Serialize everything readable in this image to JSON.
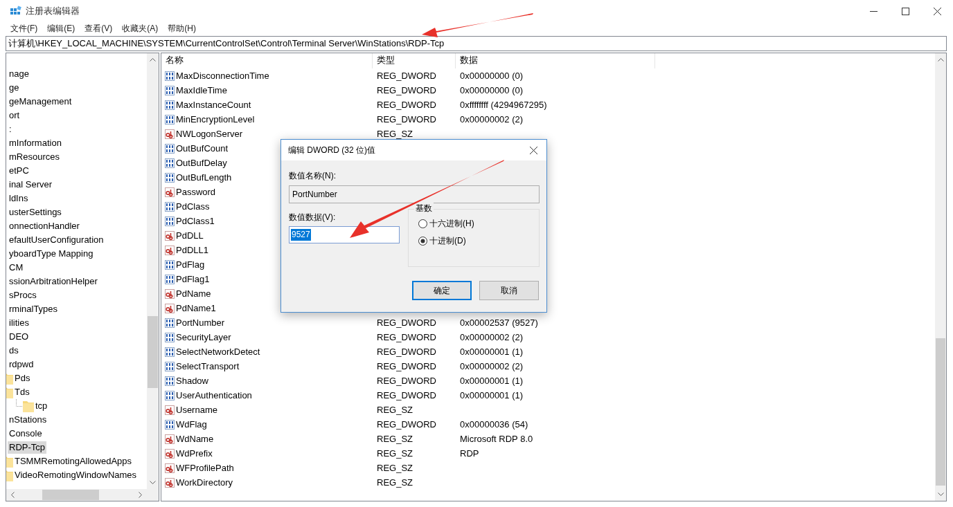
{
  "window": {
    "title": "注册表编辑器"
  },
  "menu": [
    "文件(F)",
    "编辑(E)",
    "查看(V)",
    "收藏夹(A)",
    "帮助(H)"
  ],
  "address": "计算机\\HKEY_LOCAL_MACHINE\\SYSTEM\\CurrentControlSet\\Control\\Terminal Server\\WinStations\\RDP-Tcp",
  "tree": [
    {
      "text": "nage",
      "selected": false
    },
    {
      "text": "ge",
      "selected": false
    },
    {
      "text": "geManagement",
      "selected": false
    },
    {
      "text": "ort",
      "selected": false
    },
    {
      "text": ":",
      "selected": false
    },
    {
      "text": "mInformation",
      "selected": false
    },
    {
      "text": "mResources",
      "selected": false
    },
    {
      "text": "etPC",
      "selected": false
    },
    {
      "text": "inal Server",
      "selected": false
    },
    {
      "text": "ldIns",
      "selected": false
    },
    {
      "text": "usterSettings",
      "selected": false
    },
    {
      "text": "onnectionHandler",
      "selected": false
    },
    {
      "text": "efaultUserConfiguration",
      "selected": false
    },
    {
      "text": "yboardType Mapping",
      "selected": false
    },
    {
      "text": "CM",
      "selected": false
    },
    {
      "text": "ssionArbitrationHelper",
      "selected": false
    },
    {
      "text": "sProcs",
      "selected": false
    },
    {
      "text": "rminalTypes",
      "selected": false
    },
    {
      "text": "ilities",
      "selected": false
    },
    {
      "text": "DEO",
      "selected": false
    },
    {
      "text": "ds",
      "selected": false,
      "children": [
        {
          "text": "rdpwd",
          "selected": false,
          "children": [
            {
              "text": "Pds",
              "selected": false
            },
            {
              "text": "Tds",
              "selected": false,
              "children": [
                {
                  "text": "tcp",
                  "selected": false
                }
              ]
            }
          ]
        }
      ]
    },
    {
      "text": "nStations",
      "selected": false,
      "children": [
        {
          "text": "Console",
          "selected": false
        },
        {
          "text": "RDP-Tcp",
          "selected": true,
          "children": [
            {
              "text": "TSMMRemotingAllowedApps",
              "selected": false
            },
            {
              "text": "VideoRemotingWindowNames",
              "selected": false
            }
          ]
        }
      ]
    }
  ],
  "table": {
    "columns": [
      "名称",
      "类型",
      "数据"
    ],
    "rows": [
      {
        "name": "MaxDisconnectionTime",
        "kind": "dword",
        "type": "REG_DWORD",
        "data": "0x00000000 (0)"
      },
      {
        "name": "MaxIdleTime",
        "kind": "dword",
        "type": "REG_DWORD",
        "data": "0x00000000 (0)"
      },
      {
        "name": "MaxInstanceCount",
        "kind": "dword",
        "type": "REG_DWORD",
        "data": "0xffffffff (4294967295)"
      },
      {
        "name": "MinEncryptionLevel",
        "kind": "dword",
        "type": "REG_DWORD",
        "data": "0x00000002 (2)"
      },
      {
        "name": "NWLogonServer",
        "kind": "sz",
        "type": "REG_SZ"
      },
      {
        "name": "OutBufCount",
        "kind": "dword"
      },
      {
        "name": "OutBufDelay",
        "kind": "dword"
      },
      {
        "name": "OutBufLength",
        "kind": "dword"
      },
      {
        "name": "Password",
        "kind": "sz"
      },
      {
        "name": "PdClass",
        "kind": "dword"
      },
      {
        "name": "PdClass1",
        "kind": "dword"
      },
      {
        "name": "PdDLL",
        "kind": "sz"
      },
      {
        "name": "PdDLL1",
        "kind": "sz"
      },
      {
        "name": "PdFlag",
        "kind": "dword"
      },
      {
        "name": "PdFlag1",
        "kind": "dword"
      },
      {
        "name": "PdName",
        "kind": "sz"
      },
      {
        "name": "PdName1",
        "kind": "sz"
      },
      {
        "name": "PortNumber",
        "kind": "dword",
        "type": "REG_DWORD",
        "data": "0x00002537 (9527)"
      },
      {
        "name": "SecurityLayer",
        "kind": "dword",
        "type": "REG_DWORD",
        "data": "0x00000002 (2)"
      },
      {
        "name": "SelectNetworkDetect",
        "kind": "dword",
        "type": "REG_DWORD",
        "data": "0x00000001 (1)"
      },
      {
        "name": "SelectTransport",
        "kind": "dword",
        "type": "REG_DWORD",
        "data": "0x00000002 (2)"
      },
      {
        "name": "Shadow",
        "kind": "dword",
        "type": "REG_DWORD",
        "data": "0x00000001 (1)"
      },
      {
        "name": "UserAuthentication",
        "kind": "dword",
        "type": "REG_DWORD",
        "data": "0x00000001 (1)"
      },
      {
        "name": "Username",
        "kind": "sz",
        "type": "REG_SZ"
      },
      {
        "name": "WdFlag",
        "kind": "dword",
        "type": "REG_DWORD",
        "data": "0x00000036 (54)"
      },
      {
        "name": "WdName",
        "kind": "sz",
        "type": "REG_SZ",
        "data": "Microsoft RDP 8.0"
      },
      {
        "name": "WdPrefix",
        "kind": "sz",
        "type": "REG_SZ",
        "data": "RDP"
      },
      {
        "name": "WFProfilePath",
        "kind": "sz",
        "type": "REG_SZ"
      },
      {
        "name": "WorkDirectory",
        "kind": "sz",
        "type": "REG_SZ"
      }
    ]
  },
  "dialog": {
    "title": "编辑 DWORD (32 位)值",
    "name_label": "数值名称(N):",
    "name_value": "PortNumber",
    "data_label": "数值数据(V):",
    "data_value": "9527",
    "base_label": "基数",
    "radios": [
      {
        "label": "十六进制(H)",
        "selected": false
      },
      {
        "label": "十进制(D)",
        "selected": true
      }
    ],
    "buttons": [
      {
        "label": "确定",
        "default": true
      },
      {
        "label": "取消",
        "default": false
      }
    ]
  }
}
